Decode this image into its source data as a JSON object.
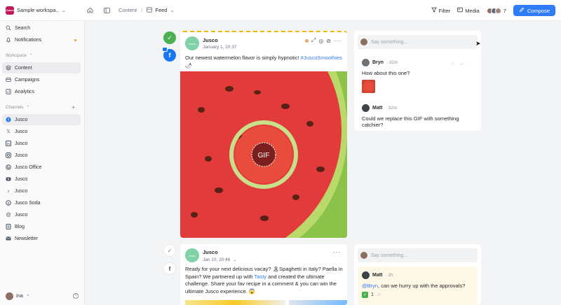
{
  "topbar": {
    "workspace_logo": "Jusco",
    "workspace_name": "Sample workspa...",
    "crumb_content": "Content",
    "crumb_sep": "/",
    "crumb_feed": "Feed",
    "filter_label": "Filter",
    "media_label": "Media",
    "avatars_count": "7",
    "compose_label": "Compose",
    "accent": "#2f7cf6"
  },
  "sidebar": {
    "search": "Search",
    "notifications": "Notifications",
    "workspace_header": "Workspace",
    "workspace_items": [
      "Content",
      "Campaigns",
      "Analytics"
    ],
    "channels_header": "Channels",
    "channels": [
      {
        "label": "Jusco",
        "icon": "facebook-icon"
      },
      {
        "label": "Jusco",
        "icon": "x-icon"
      },
      {
        "label": "Jusco",
        "icon": "linkedin-icon"
      },
      {
        "label": "Jusco",
        "icon": "instagram-icon"
      },
      {
        "label": "Jusco Office",
        "icon": "google-business-icon"
      },
      {
        "label": "Jusco",
        "icon": "youtube-icon"
      },
      {
        "label": "Jusco",
        "icon": "tiktok-icon"
      },
      {
        "label": "Jusco Soda",
        "icon": "pinterest-icon"
      },
      {
        "label": "Jusco",
        "icon": "threads-icon"
      },
      {
        "label": "Blog",
        "icon": "blog-icon"
      },
      {
        "label": "Newsletter",
        "icon": "newsletter-icon"
      }
    ],
    "user_name": "Ina"
  },
  "post1": {
    "avatar_text": "Jusco",
    "author": "Jusco",
    "date": "January 1, 20:37",
    "text_before": "Our newest watermelon flavor is simply hypnotic! ",
    "hashtag": "#JuscoSmoothies",
    "emoji_after": "🌶",
    "gif_label": "GIF"
  },
  "post2": {
    "avatar_text": "Jusco",
    "author": "Jusco",
    "date": "Jan 10, 20:46",
    "text_1": "Ready for your next delicious vacay? 🏝Spaghetti in Italy? Paella in Spain? We partnered up with ",
    "tasty": "Tasty",
    "text_2": " and created the ultimate challenge. Share your fav recipe in a comment & you can win the ultimate Jusco experience. 😱"
  },
  "comments1": {
    "placeholder": "Say something...",
    "c1_name": "Bryn",
    "c1_time": "· 32m",
    "c1_text": "How about this one?",
    "c2_name": "Matt",
    "c2_time": "· 32m",
    "c2_text": "Could we replace this GIF with something catchier?"
  },
  "comments2": {
    "placeholder": "Say something...",
    "c1_name": "Matt",
    "c1_time": "· 2h",
    "mention": "@Bryn",
    "c1_text": ", can we hurry up with the approvals?",
    "vote_count": "1"
  }
}
